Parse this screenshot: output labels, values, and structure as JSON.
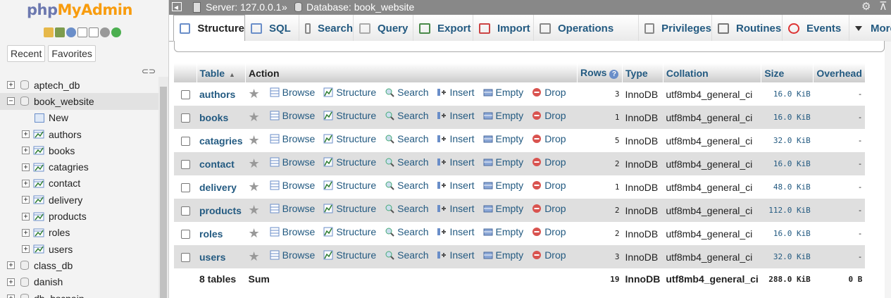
{
  "nav": {
    "logo_php": "php",
    "logo_myadmin": "MyAdmin",
    "tabs": [
      "Recent",
      "Favorites"
    ],
    "tree": [
      {
        "label": "aptech_db",
        "kind": "db",
        "expanded": false
      },
      {
        "label": "book_website",
        "kind": "db",
        "expanded": true
      },
      {
        "label": "New",
        "kind": "new"
      },
      {
        "label": "authors",
        "kind": "table"
      },
      {
        "label": "books",
        "kind": "table"
      },
      {
        "label": "catagries",
        "kind": "table"
      },
      {
        "label": "contact",
        "kind": "table"
      },
      {
        "label": "delivery",
        "kind": "table"
      },
      {
        "label": "products",
        "kind": "table"
      },
      {
        "label": "roles",
        "kind": "table"
      },
      {
        "label": "users",
        "kind": "table"
      },
      {
        "label": "class_db",
        "kind": "db",
        "expanded": false
      },
      {
        "label": "danish",
        "kind": "db",
        "expanded": false
      },
      {
        "label": "db_bscpaip",
        "kind": "db",
        "expanded": false
      }
    ]
  },
  "topbar": {
    "server": "Server: 127.0.0.1",
    "separator": "»",
    "database": "Database: book_website"
  },
  "tabs": [
    {
      "label": "Structure",
      "icon": "structure-icon",
      "active": true
    },
    {
      "label": "SQL",
      "icon": "sql-icon"
    },
    {
      "label": "Search",
      "icon": "search-icon"
    },
    {
      "label": "Query",
      "icon": "query-icon"
    },
    {
      "label": "Export",
      "icon": "export-icon"
    },
    {
      "label": "Import",
      "icon": "import-icon"
    },
    {
      "label": "Operations",
      "icon": "wrench-icon"
    },
    {
      "label": "Privileges",
      "icon": "privileges-icon"
    },
    {
      "label": "Routines",
      "icon": "routines-icon"
    },
    {
      "label": "Events",
      "icon": "clock-icon"
    },
    {
      "label": "More",
      "icon": "chevron-down-icon"
    }
  ],
  "table": {
    "headers": {
      "table": "Table",
      "action": "Action",
      "rows": "Rows",
      "type": "Type",
      "collation": "Collation",
      "size": "Size",
      "overhead": "Overhead"
    },
    "actions": [
      "Browse",
      "Structure",
      "Search",
      "Insert",
      "Empty",
      "Drop"
    ],
    "rows": [
      {
        "name": "authors",
        "rows": "3",
        "type": "InnoDB",
        "collation": "utf8mb4_general_ci",
        "size": "16.0 KiB",
        "overhead": "-"
      },
      {
        "name": "books",
        "rows": "1",
        "type": "InnoDB",
        "collation": "utf8mb4_general_ci",
        "size": "16.0 KiB",
        "overhead": "-"
      },
      {
        "name": "catagries",
        "rows": "5",
        "type": "InnoDB",
        "collation": "utf8mb4_general_ci",
        "size": "32.0 KiB",
        "overhead": "-"
      },
      {
        "name": "contact",
        "rows": "2",
        "type": "InnoDB",
        "collation": "utf8mb4_general_ci",
        "size": "16.0 KiB",
        "overhead": "-"
      },
      {
        "name": "delivery",
        "rows": "1",
        "type": "InnoDB",
        "collation": "utf8mb4_general_ci",
        "size": "48.0 KiB",
        "overhead": "-"
      },
      {
        "name": "products",
        "rows": "2",
        "type": "InnoDB",
        "collation": "utf8mb4_general_ci",
        "size": "112.0 KiB",
        "overhead": "-"
      },
      {
        "name": "roles",
        "rows": "2",
        "type": "InnoDB",
        "collation": "utf8mb4_general_ci",
        "size": "16.0 KiB",
        "overhead": "-"
      },
      {
        "name": "users",
        "rows": "3",
        "type": "InnoDB",
        "collation": "utf8mb4_general_ci",
        "size": "32.0 KiB",
        "overhead": "-"
      }
    ],
    "footer": {
      "count": "8 tables",
      "sum": "Sum",
      "rows": "19",
      "type": "InnoDB",
      "collation": "utf8mb4_general_ci",
      "size": "288.0 KiB",
      "overhead": "0 B"
    }
  },
  "colors": {
    "link": "#235a81",
    "topbar": "#888888",
    "drop": "#d9534f",
    "row_alt": "#dfdfdf"
  }
}
